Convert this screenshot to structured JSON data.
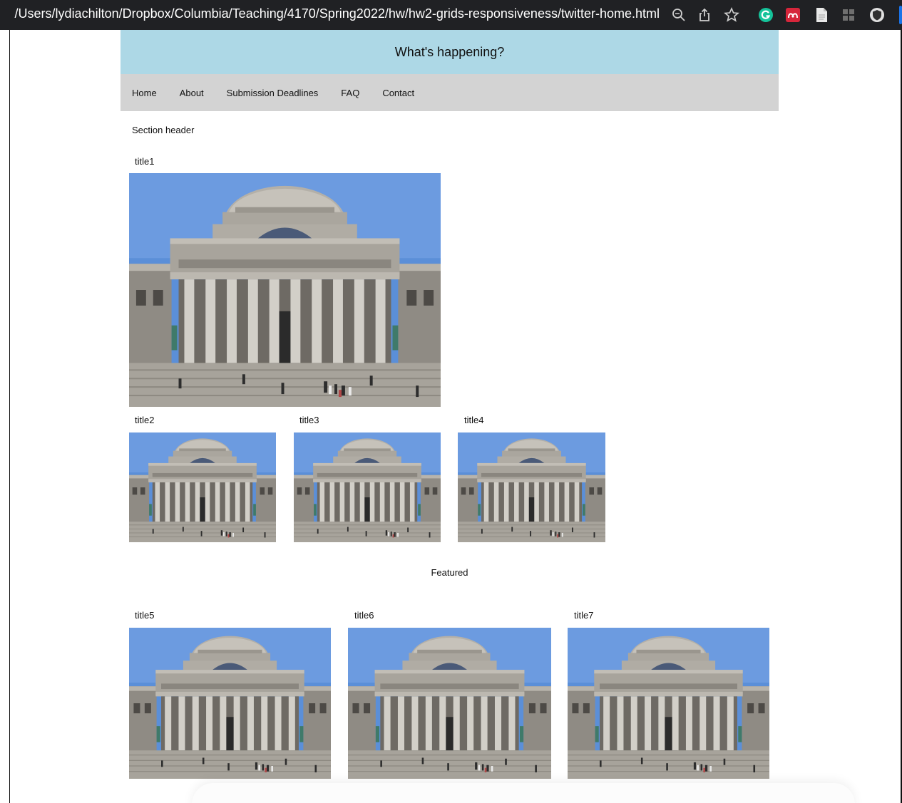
{
  "browser": {
    "url": "/Users/lydiachilton/Dropbox/Columbia/Teaching/4170/Spring2022/hw/hw2-grids-responsiveness/twitter-home.html",
    "icons": [
      "zoom-icon",
      "share-icon",
      "bookmark-star-icon",
      "grammarly-extension-icon",
      "mendeley-extension-icon",
      "document-extension-icon",
      "grid-extension-icon",
      "shield-extension-icon"
    ]
  },
  "banner": {
    "title": "What's happening?"
  },
  "nav": {
    "items": [
      "Home",
      "About",
      "Submission Deadlines",
      "FAQ",
      "Contact"
    ]
  },
  "section_header": "Section header",
  "row1": {
    "titles": [
      "title1"
    ]
  },
  "row2": {
    "titles": [
      "title2",
      "title3",
      "title4"
    ]
  },
  "featured": "Featured",
  "row3": {
    "titles": [
      "title5",
      "title6",
      "title7"
    ]
  },
  "colors": {
    "banner": "#add8e6",
    "nav": "#d3d3d3",
    "chrome": "#202124",
    "sky": "#5b8fd8",
    "stone": "#a8a49c"
  }
}
